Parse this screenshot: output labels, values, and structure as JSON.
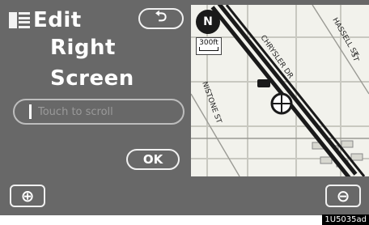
{
  "header": {
    "title": "Edit",
    "line2": "Right",
    "line3": "Screen",
    "back_label": "⮌"
  },
  "search": {
    "placeholder": "Touch to scroll"
  },
  "actions": {
    "ok_label": "OK",
    "zoom_in_label": "⊕",
    "zoom_out_label": "⊖"
  },
  "map": {
    "compass_label": "N",
    "scale_label": "300ft",
    "streets": [
      "HASSELL ST",
      "CHRYSLER DR",
      "NISTONE ST",
      "ST"
    ]
  },
  "figure_code": "1U5035ad",
  "colors": {
    "panel_bg": "#686868",
    "map_bg": "#f2f2ec",
    "road": "#1a1a1a"
  }
}
